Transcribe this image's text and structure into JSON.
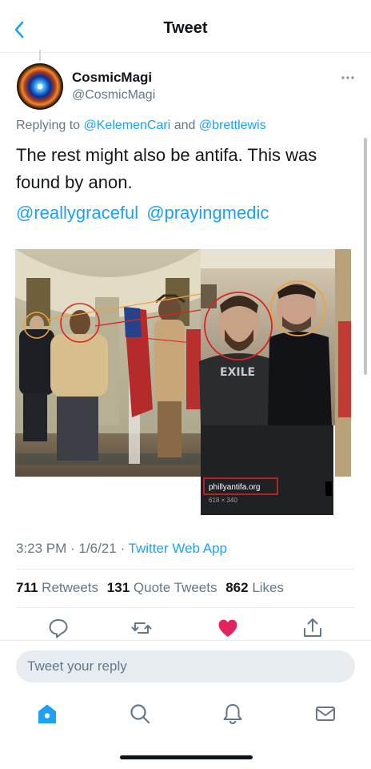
{
  "header": {
    "title": "Tweet"
  },
  "author": {
    "name": "CosmicMagi",
    "handle": "@CosmicMagi"
  },
  "reply": {
    "prefix": "Replying to",
    "mentions": [
      "@KelemenCari",
      "@brettlewis"
    ],
    "joiner": "and"
  },
  "tweet": {
    "text": "The rest might also be antifa. This was found by anon.",
    "mentions": [
      "@reallygraceful",
      "@prayingmedic"
    ]
  },
  "media": {
    "caption_link": "phillyantifa.org",
    "caption_dims": "618 × 340",
    "shirt_text": "EXILE"
  },
  "meta": {
    "time": "3:23 PM",
    "date": "1/6/21",
    "sep": "·",
    "source": "Twitter Web App"
  },
  "stats": {
    "retweets_count": "711",
    "retweets_label": "Retweets",
    "quotes_count": "131",
    "quotes_label": "Quote Tweets",
    "likes_count": "862",
    "likes_label": "Likes"
  },
  "actions": [
    "reply-icon",
    "retweet-icon",
    "like-icon",
    "share-icon"
  ],
  "composer": {
    "placeholder": "Tweet your reply"
  },
  "tabs": [
    "home-icon",
    "search-icon",
    "notifications-icon",
    "messages-icon"
  ],
  "colors": {
    "accent": "#1da1f2",
    "like": "#e0245e",
    "secondary_text": "#657786",
    "annotation_orange": "#f0a040",
    "annotation_red": "#d8251d"
  }
}
